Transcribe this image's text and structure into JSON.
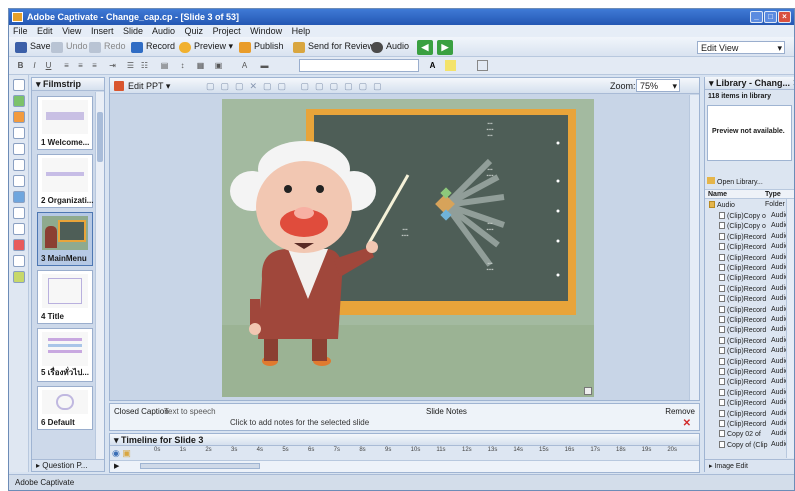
{
  "window": {
    "title": "Adobe Captivate - Change_cap.cp - [Slide 3 of 53]"
  },
  "menu": [
    "File",
    "Edit",
    "View",
    "Insert",
    "Slide",
    "Audio",
    "Quiz",
    "Project",
    "Window",
    "Help"
  ],
  "toolbar": {
    "save": "Save",
    "undo": "Undo",
    "redo": "Redo",
    "record": "Record",
    "preview": "Preview",
    "publish": "Publish",
    "send_review": "Send for Review",
    "audio": "Audio",
    "view_select": "Edit View"
  },
  "filmstrip": {
    "title": "Filmstrip",
    "slides": [
      {
        "label": "1 Welcome..."
      },
      {
        "label": "2 Organizati..."
      },
      {
        "label": "3 MainMenu",
        "active": true
      },
      {
        "label": "4 Title"
      },
      {
        "label": "5 เรื่องทั่วไป..."
      },
      {
        "label": "6 Default"
      }
    ],
    "footer": "Question P..."
  },
  "editor": {
    "tab": "Edit PPT",
    "zoom_label": "Zoom:",
    "zoom_value": "75%"
  },
  "caption_bar": {
    "closed_caption": "Closed Caption",
    "text_to_speech": "Text to speech",
    "placeholder": "Click to add notes for the selected slide",
    "slide_notes": "Slide Notes",
    "remove": "Remove"
  },
  "timeline": {
    "title": "Timeline for Slide 3",
    "marks": [
      "0s",
      "1s",
      "2s",
      "3s",
      "4s",
      "5s",
      "6s",
      "7s",
      "8s",
      "9s",
      "10s",
      "11s",
      "12s",
      "13s",
      "14s",
      "15s",
      "16s",
      "17s",
      "18s",
      "19s",
      "20s"
    ]
  },
  "library": {
    "title": "Library - Chang...",
    "items_count": "118 items in library",
    "preview": "Preview not available.",
    "open_library": "Open Library...",
    "col_name": "Name",
    "col_type": "Type",
    "folder": "Audio",
    "folder_type": "Folder",
    "items": [
      {
        "name": "(Clip)Copy o",
        "type": "Audio"
      },
      {
        "name": "(Clip)Copy o",
        "type": "Audio"
      },
      {
        "name": "(Clip)Record",
        "type": "Audio"
      },
      {
        "name": "(Clip)Record",
        "type": "Audio"
      },
      {
        "name": "(Clip)Record",
        "type": "Audio"
      },
      {
        "name": "(Clip)Record",
        "type": "Audio"
      },
      {
        "name": "(Clip)Record",
        "type": "Audio"
      },
      {
        "name": "(Clip)Record",
        "type": "Audio"
      },
      {
        "name": "(Clip)Record",
        "type": "Audio"
      },
      {
        "name": "(Clip)Record",
        "type": "Audio"
      },
      {
        "name": "(Clip)Record",
        "type": "Audio"
      },
      {
        "name": "(Clip)Record",
        "type": "Audio"
      },
      {
        "name": "(Clip)Record",
        "type": "Audio"
      },
      {
        "name": "(Clip)Record",
        "type": "Audio"
      },
      {
        "name": "(Clip)Record",
        "type": "Audio"
      },
      {
        "name": "(Clip)Record",
        "type": "Audio"
      },
      {
        "name": "(Clip)Record",
        "type": "Audio"
      },
      {
        "name": "(Clip)Record",
        "type": "Audio"
      },
      {
        "name": "(Clip)Record",
        "type": "Audio"
      },
      {
        "name": "(Clip)Record",
        "type": "Audio"
      },
      {
        "name": "(Clip)Record",
        "type": "Audio"
      },
      {
        "name": "Copy 02 of",
        "type": "Audio"
      },
      {
        "name": "Copy of (Clip",
        "type": "Audio"
      }
    ],
    "footer": "Image Edit"
  },
  "statusbar": "Adobe Captivate"
}
